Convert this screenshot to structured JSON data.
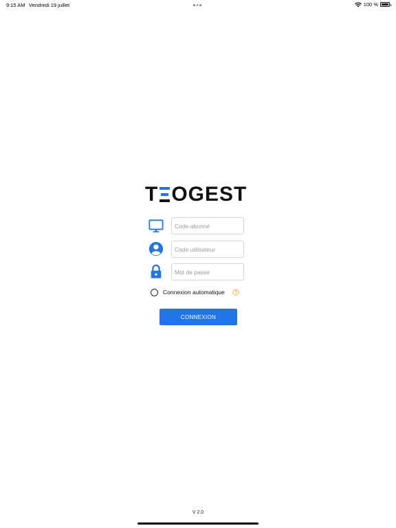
{
  "status_bar": {
    "time": "9:15 AM",
    "date": "Vendredi 19 juillet",
    "battery": "100 %",
    "battery_level": 1.0
  },
  "logo": {
    "prefix": "T",
    "suffix": "OGEST",
    "accent_color": "#2275e6"
  },
  "form": {
    "subscriber_code": {
      "placeholder": "Code abonné",
      "value": "",
      "icon": "monitor-icon"
    },
    "user_code": {
      "placeholder": "Code utilisateur",
      "value": "",
      "icon": "user-icon"
    },
    "password": {
      "placeholder": "Mot de passe",
      "value": "",
      "icon": "lock-icon"
    },
    "auto_login": {
      "label": "Connexion automatique",
      "checked": false,
      "help_icon": "help-icon",
      "help_color": "#f0a020"
    },
    "submit_label": "CONNEXION",
    "submit_color": "#2275e6"
  },
  "footer": {
    "version": "V 2.0"
  }
}
